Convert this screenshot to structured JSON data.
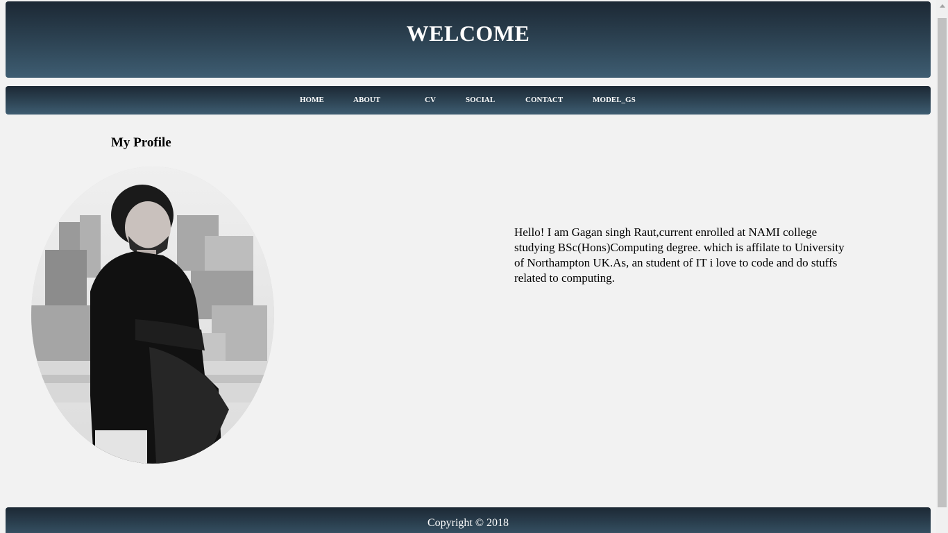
{
  "header": {
    "title": "WELCOME"
  },
  "nav": {
    "items": [
      {
        "label": "HOME"
      },
      {
        "label": "ABOUT"
      },
      {
        "label": "CV"
      },
      {
        "label": "SOCIAL"
      },
      {
        "label": "CONTACT"
      },
      {
        "label": "MODEL_GS"
      }
    ]
  },
  "profile": {
    "title": "My Profile",
    "photo_icon": "profile-photo",
    "bio": "Hello! I am Gagan singh Raut,current enrolled at NAMI college studying BSc(Hons)Computing degree. which is affilate to University of Northampton UK.As, an student of IT i love to code and do stuffs related to computing."
  },
  "footer": {
    "copyright": "Copyright © 2018"
  },
  "colors": {
    "bar_dark": "#1c2834",
    "bar_light": "#3e5d72",
    "page_bg": "#f2f2f2"
  }
}
